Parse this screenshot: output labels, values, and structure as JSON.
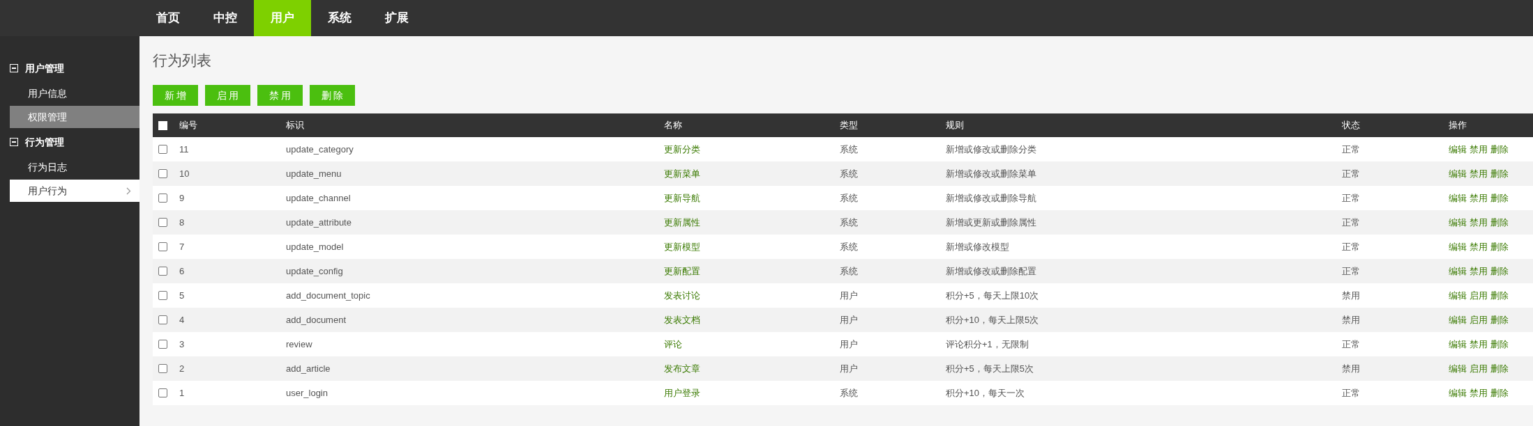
{
  "top_nav": [
    {
      "label": "首页",
      "selected": false
    },
    {
      "label": "中控",
      "selected": false
    },
    {
      "label": "用户",
      "selected": true
    },
    {
      "label": "系统",
      "selected": false
    },
    {
      "label": "扩展",
      "selected": false
    }
  ],
  "sidebar": {
    "groups": [
      {
        "title": "用户管理",
        "expanded": true,
        "items": [
          {
            "label": "用户信息",
            "selected": false,
            "hovered": false
          },
          {
            "label": "权限管理",
            "selected": false,
            "hovered": true
          }
        ]
      },
      {
        "title": "行为管理",
        "expanded": true,
        "items": [
          {
            "label": "行为日志",
            "selected": false,
            "hovered": false
          },
          {
            "label": "用户行为",
            "selected": true,
            "hovered": false
          }
        ]
      }
    ]
  },
  "page_title": "行为列表",
  "toolbar": [
    "新 增",
    "启 用",
    "禁 用",
    "删 除"
  ],
  "table": {
    "select_all": {
      "checked": false
    },
    "columns": [
      "编号",
      "标识",
      "名称",
      "类型",
      "规则",
      "状态",
      "操作"
    ],
    "rows": [
      {
        "checked": false,
        "id": "11",
        "key": "update_category",
        "name": "更新分类",
        "type": "系统",
        "rule": "新增或修改或删除分类",
        "status": "正常",
        "actions": [
          "编辑",
          "禁用",
          "删除"
        ]
      },
      {
        "checked": false,
        "id": "10",
        "key": "update_menu",
        "name": "更新菜单",
        "type": "系统",
        "rule": "新增或修改或删除菜单",
        "status": "正常",
        "actions": [
          "编辑",
          "禁用",
          "删除"
        ]
      },
      {
        "checked": false,
        "id": "9",
        "key": "update_channel",
        "name": "更新导航",
        "type": "系统",
        "rule": "新增或修改或删除导航",
        "status": "正常",
        "actions": [
          "编辑",
          "禁用",
          "删除"
        ]
      },
      {
        "checked": false,
        "id": "8",
        "key": "update_attribute",
        "name": "更新属性",
        "type": "系统",
        "rule": "新增或更新或删除属性",
        "status": "正常",
        "actions": [
          "编辑",
          "禁用",
          "删除"
        ]
      },
      {
        "checked": false,
        "id": "7",
        "key": "update_model",
        "name": "更新模型",
        "type": "系统",
        "rule": "新增或修改模型",
        "status": "正常",
        "actions": [
          "编辑",
          "禁用",
          "删除"
        ]
      },
      {
        "checked": false,
        "id": "6",
        "key": "update_config",
        "name": "更新配置",
        "type": "系统",
        "rule": "新增或修改或删除配置",
        "status": "正常",
        "actions": [
          "编辑",
          "禁用",
          "删除"
        ]
      },
      {
        "checked": false,
        "id": "5",
        "key": "add_document_topic",
        "name": "发表讨论",
        "type": "用户",
        "rule": "积分+5，每天上限10次",
        "status": "禁用",
        "actions": [
          "编辑",
          "启用",
          "删除"
        ]
      },
      {
        "checked": false,
        "id": "4",
        "key": "add_document",
        "name": "发表文档",
        "type": "用户",
        "rule": "积分+10，每天上限5次",
        "status": "禁用",
        "actions": [
          "编辑",
          "启用",
          "删除"
        ]
      },
      {
        "checked": false,
        "id": "3",
        "key": "review",
        "name": "评论",
        "type": "用户",
        "rule": "评论积分+1，无限制",
        "status": "正常",
        "actions": [
          "编辑",
          "禁用",
          "删除"
        ]
      },
      {
        "checked": false,
        "id": "2",
        "key": "add_article",
        "name": "发布文章",
        "type": "用户",
        "rule": "积分+5，每天上限5次",
        "status": "禁用",
        "actions": [
          "编辑",
          "启用",
          "删除"
        ]
      },
      {
        "checked": false,
        "id": "1",
        "key": "user_login",
        "name": "用户登录",
        "type": "系统",
        "rule": "积分+10，每天一次",
        "status": "正常",
        "actions": [
          "编辑",
          "禁用",
          "删除"
        ]
      }
    ]
  }
}
